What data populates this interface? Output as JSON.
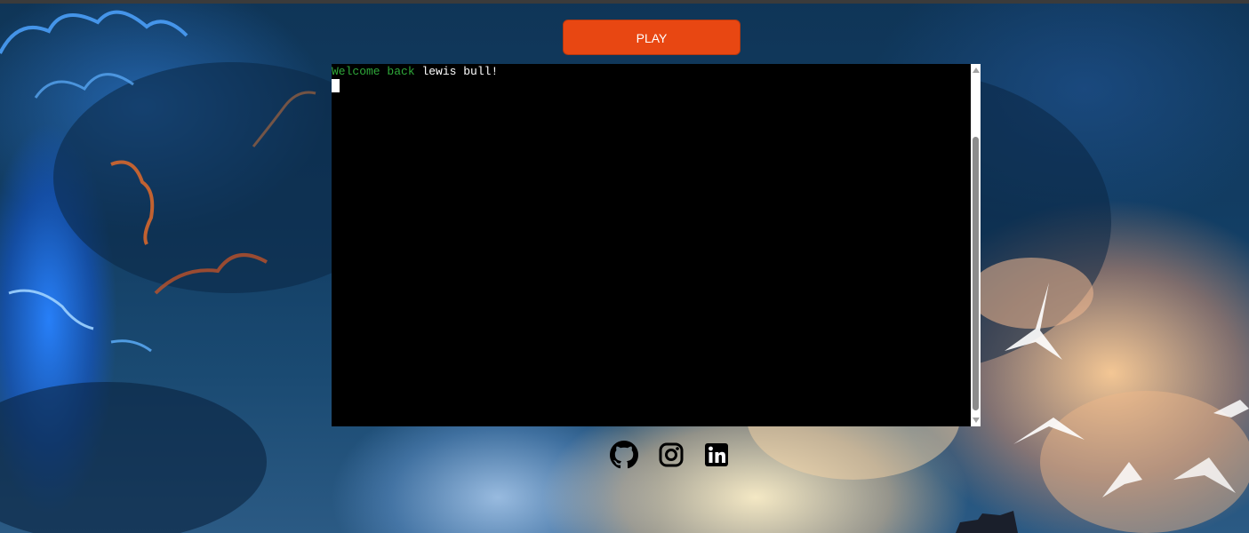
{
  "play_button": {
    "label": "PLAY"
  },
  "terminal": {
    "greeting": "Welcome back",
    "username": "lewis bull!"
  },
  "social_links": [
    {
      "icon": "github-icon"
    },
    {
      "icon": "instagram-icon"
    },
    {
      "icon": "linkedin-icon"
    }
  ],
  "colors": {
    "play_button": "#e84712",
    "terminal_bg": "#000000",
    "greeting_text": "#2fa83a",
    "username_text": "#ffffff"
  }
}
